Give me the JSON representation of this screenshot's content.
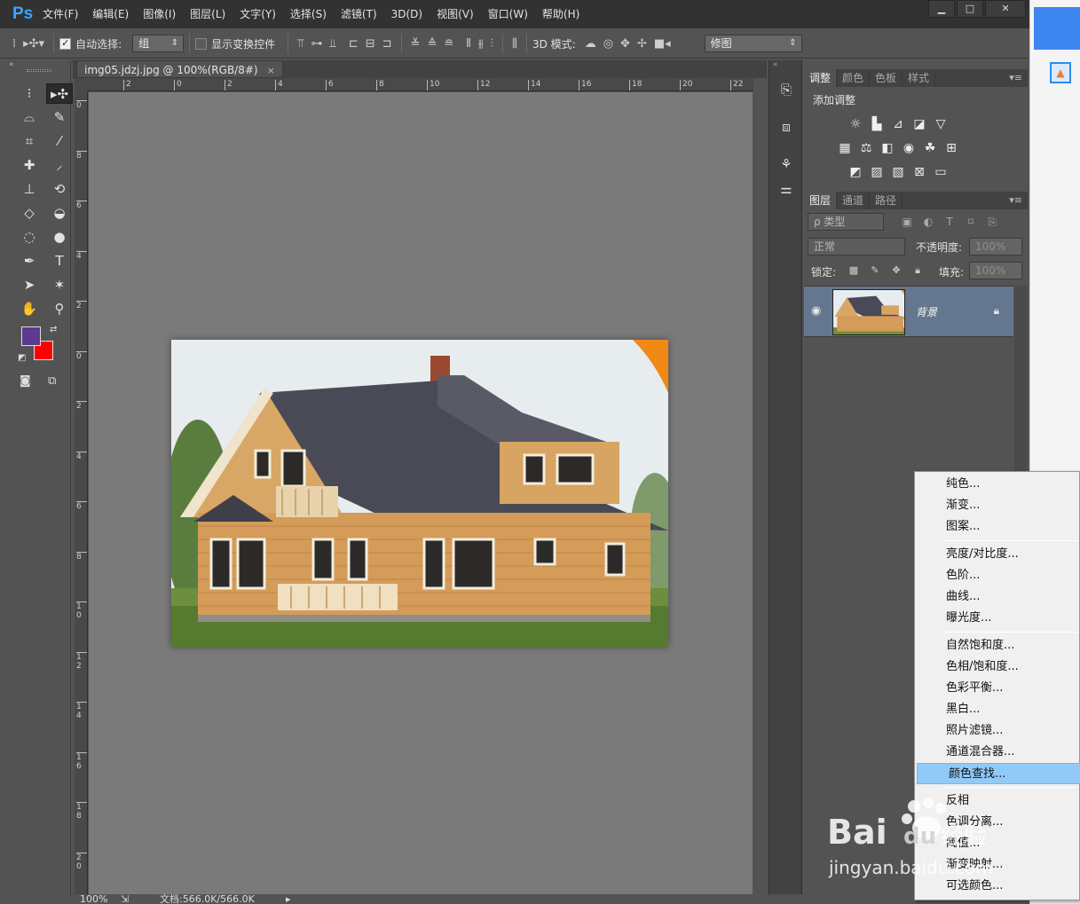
{
  "app": {
    "logo": "Ps",
    "menu": [
      "文件(F)",
      "编辑(E)",
      "图像(I)",
      "图层(L)",
      "文字(Y)",
      "选择(S)",
      "滤镜(T)",
      "3D(D)",
      "视图(V)",
      "窗口(W)",
      "帮助(H)"
    ],
    "window_buttons": {
      "minimize": "▁",
      "maximize": "□",
      "close": "✕"
    }
  },
  "options_bar": {
    "auto_select_label": "自动选择:",
    "auto_select_value": "组",
    "show_transform_label": "显示变换控件",
    "mode_3d_label": "3D 模式:",
    "workspace_value": "修图"
  },
  "document": {
    "tab_title": "img05.jdzj.jpg @ 100%(RGB/8#)",
    "tab_close": "×",
    "zoom": "100%",
    "doc_info": "文档:566.0K/566.0K"
  },
  "rulers": {
    "horizontal": [
      "2",
      "0",
      "2",
      "4",
      "6",
      "8",
      "10",
      "12",
      "14",
      "16",
      "18",
      "20",
      "22"
    ],
    "vertical": [
      "0",
      "8",
      "6",
      "4",
      "2",
      "0",
      "2",
      "4",
      "6",
      "8",
      "1 0",
      "1 2",
      "1 4",
      "1 6",
      "1 8",
      "2 0"
    ]
  },
  "colors": {
    "foreground": "#5d3a8e",
    "background": "#ff0000",
    "canvas": "#7a7a7a",
    "panel": "#535353",
    "highlight": "#91c9f7",
    "layer_selected": "#65778e"
  },
  "adjustments_panel": {
    "tabs": [
      "调整",
      "颜色",
      "色板",
      "样式"
    ],
    "title": "添加调整"
  },
  "layers_panel": {
    "tabs": [
      "图层",
      "通道",
      "路径"
    ],
    "filter_kind": "ρ 类型",
    "blend_mode": "正常",
    "opacity_label": "不透明度:",
    "opacity_value": "100%",
    "lock_label": "锁定:",
    "fill_label": "填充:",
    "fill_value": "100%",
    "layer_name": "背景"
  },
  "context_menu": {
    "items": [
      {
        "label": "纯色...",
        "group": 1
      },
      {
        "label": "渐变...",
        "group": 1
      },
      {
        "label": "图案...",
        "group": 1
      },
      {
        "label": "亮度/对比度...",
        "group": 2
      },
      {
        "label": "色阶...",
        "group": 2
      },
      {
        "label": "曲线...",
        "group": 2
      },
      {
        "label": "曝光度...",
        "group": 2
      },
      {
        "label": "自然饱和度...",
        "group": 3
      },
      {
        "label": "色相/饱和度...",
        "group": 3
      },
      {
        "label": "色彩平衡...",
        "group": 3
      },
      {
        "label": "黑白...",
        "group": 3
      },
      {
        "label": "照片滤镜...",
        "group": 3
      },
      {
        "label": "通道混合器...",
        "group": 3
      },
      {
        "label": "颜色查找...",
        "group": 3,
        "highlighted": true
      },
      {
        "label": "反相",
        "group": 4
      },
      {
        "label": "色调分离...",
        "group": 4
      },
      {
        "label": "阈值...",
        "group": 4
      },
      {
        "label": "渐变映射...",
        "group": 4
      },
      {
        "label": "可选颜色...",
        "group": 4
      }
    ]
  },
  "watermark": {
    "brand": "Bai",
    "brand2": "du",
    "brand_cn": "经验",
    "url": "jingyan.baidu.com"
  }
}
